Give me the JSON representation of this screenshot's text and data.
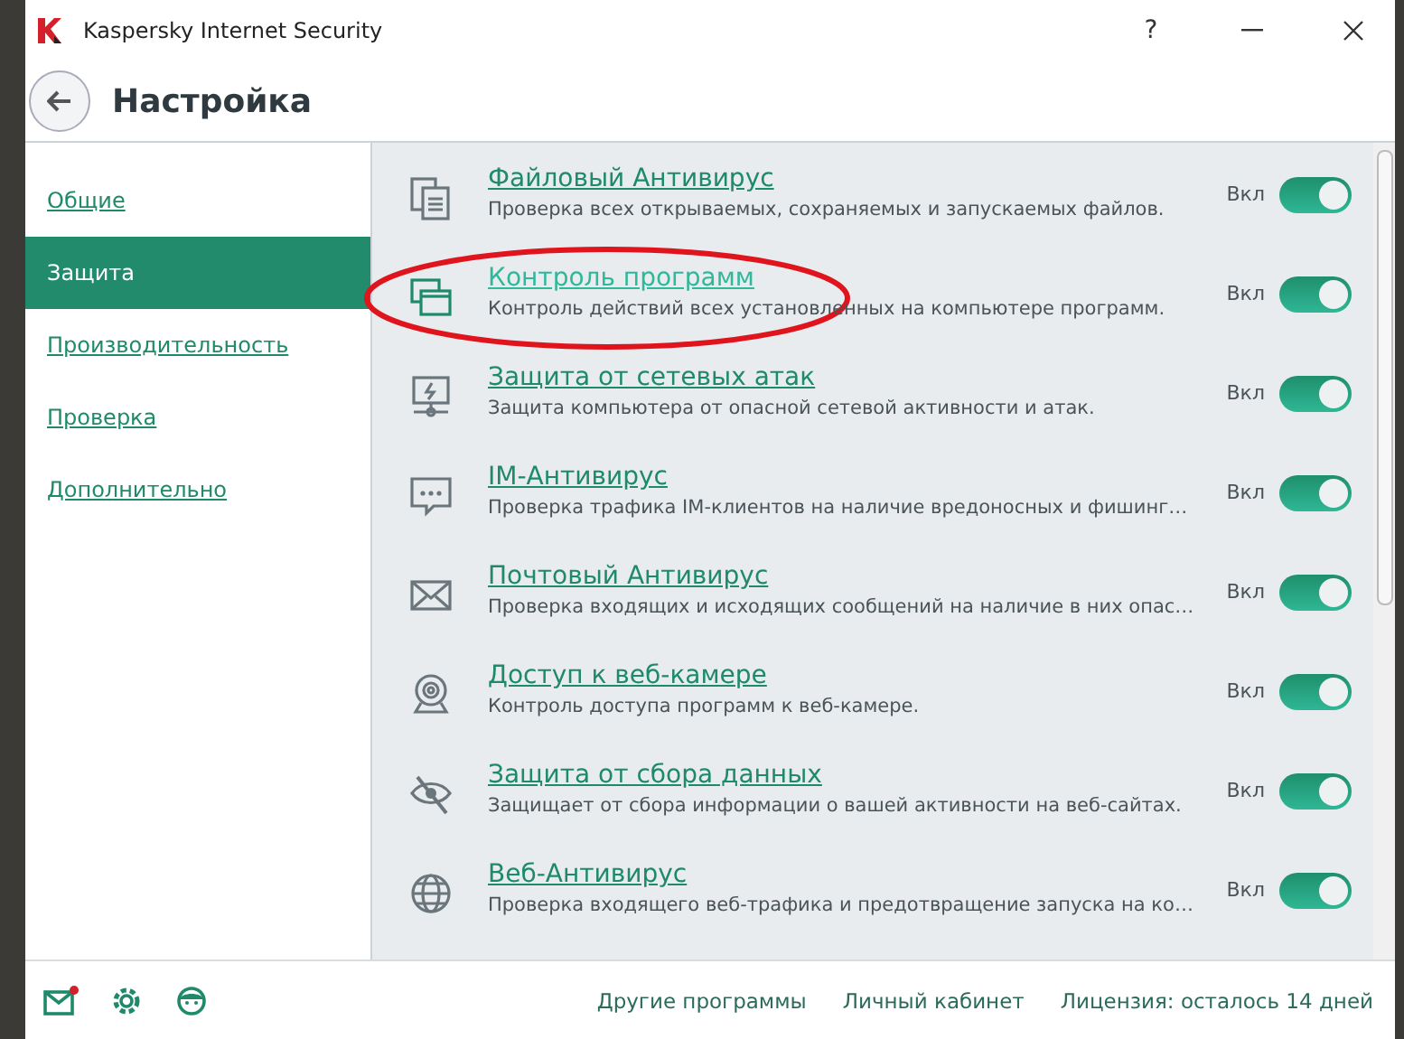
{
  "window": {
    "title": "Kaspersky Internet Security",
    "controls": [
      "?"
    ]
  },
  "header": {
    "title": "Настройка"
  },
  "sidebar": {
    "items": [
      {
        "label": "Общие",
        "selected": false
      },
      {
        "label": "Защита",
        "selected": true
      },
      {
        "label": "Производительность",
        "selected": false
      },
      {
        "label": "Проверка",
        "selected": false
      },
      {
        "label": "Дополнительно",
        "selected": false
      }
    ]
  },
  "components": [
    {
      "kind": "files",
      "title": "Файловый Антивирус",
      "description": "Проверка всех открываемых, сохраняемых и запускаемых файлов.",
      "state_label": "Вкл",
      "on": true,
      "circled": false
    },
    {
      "kind": "windows",
      "title": "Контроль программ",
      "description": "Контроль действий всех установленных на компьютере программ.",
      "state_label": "Вкл",
      "on": true,
      "circled": true
    },
    {
      "kind": "network",
      "title": "Защита от сетевых атак",
      "description": "Защита компьютера от опасной сетевой активности и атак.",
      "state_label": "Вкл",
      "on": true,
      "circled": false
    },
    {
      "kind": "chat",
      "title": "IM-Антивирус",
      "description": "Проверка трафика IM-клиентов на наличие вредоносных и фишинг…",
      "state_label": "Вкл",
      "on": true,
      "circled": false
    },
    {
      "kind": "mail",
      "title": "Почтовый Антивирус",
      "description": "Проверка входящих и исходящих сообщений на наличие в них опас…",
      "state_label": "Вкл",
      "on": true,
      "circled": false
    },
    {
      "kind": "webcam",
      "title": "Доступ к веб-камере",
      "description": "Контроль доступа программ к веб-камере.",
      "state_label": "Вкл",
      "on": true,
      "circled": false
    },
    {
      "kind": "eye",
      "title": "Защита от сбора данных",
      "description": "Защищает от сбора информации о вашей активности на веб-сайтах.",
      "state_label": "Вкл",
      "on": true,
      "circled": false
    },
    {
      "kind": "globe",
      "title": "Веб-Антивирус",
      "description": "Проверка входящего веб-трафика и предотвращение запуска на ко…",
      "state_label": "Вкл",
      "on": true,
      "circled": false
    }
  ],
  "footer": {
    "links": [
      "Другие программы",
      "Личный кабинет",
      "Лицензия: осталось 14 дней"
    ]
  }
}
